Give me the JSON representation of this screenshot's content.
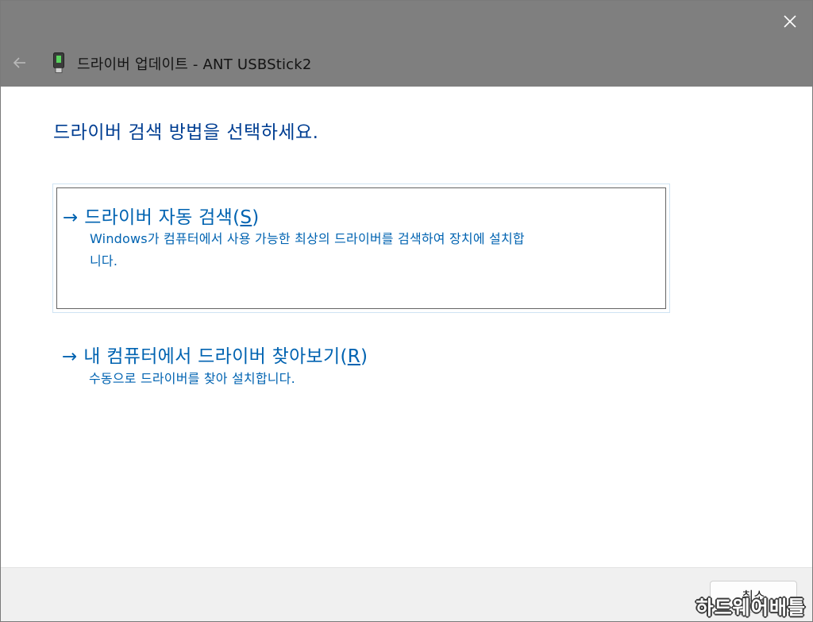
{
  "window": {
    "nav_title": "드라이버 업데이트 - ANT USBStick2"
  },
  "icons": {
    "close": "close-icon",
    "back": "back-arrow-icon",
    "device": "usb-device-icon",
    "option_arrow": "right-arrow-icon"
  },
  "main": {
    "heading": "드라이버 검색 방법을 선택하세요.",
    "options": [
      {
        "arrow": "→",
        "title": "드라이버 자동 검색(",
        "accesskey": "S",
        "title_end": ")",
        "description_line1": "Windows가 컴퓨터에서 사용 가능한 최상의 드라이버를 검색하여 장치에 설치합",
        "description_line2": "니다."
      },
      {
        "arrow": "→",
        "title": "내 컴퓨터에서 드라이버 찾아보기(",
        "accesskey": "R",
        "title_end": ")",
        "description_line1": "수동으로 드라이버를 찾아 설치합니다."
      }
    ]
  },
  "footer": {
    "cancel_label": "취소"
  },
  "watermark": "하드웨어배틀",
  "colors": {
    "titlebar_bg": "#7f7f7f",
    "heading": "#003e92",
    "link": "#0063b1",
    "footer_bg": "#f0f0f0"
  }
}
